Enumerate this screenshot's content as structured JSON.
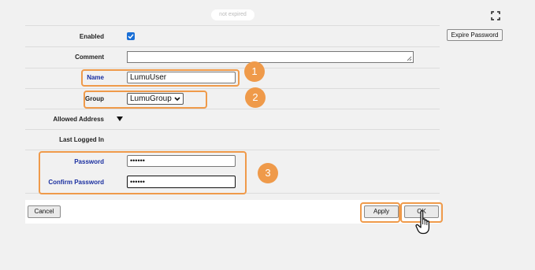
{
  "status": {
    "expiry_text": "not expired"
  },
  "actions": {
    "expire_password_label": "Expire Password"
  },
  "form": {
    "enabled": {
      "label": "Enabled",
      "checked": true
    },
    "comment": {
      "label": "Comment",
      "value": ""
    },
    "name": {
      "label": "Name",
      "value": "LumuUser"
    },
    "group": {
      "label": "Group",
      "selected": "LumuGroup"
    },
    "allowed_address": {
      "label": "Allowed Address"
    },
    "last_logged_in": {
      "label": "Last Logged In",
      "value": ""
    },
    "password": {
      "label": "Password",
      "value": "••••••"
    },
    "confirm_password": {
      "label": "Confirm Password",
      "value": "••••••"
    }
  },
  "footer": {
    "cancel_label": "Cancel",
    "apply_label": "Apply",
    "ok_label": "OK"
  },
  "callouts": [
    "1",
    "2",
    "3"
  ],
  "colors": {
    "highlight": "#ef9a4a",
    "label_blue": "#1a2fa0",
    "checkbox": "#1a6fd6"
  }
}
